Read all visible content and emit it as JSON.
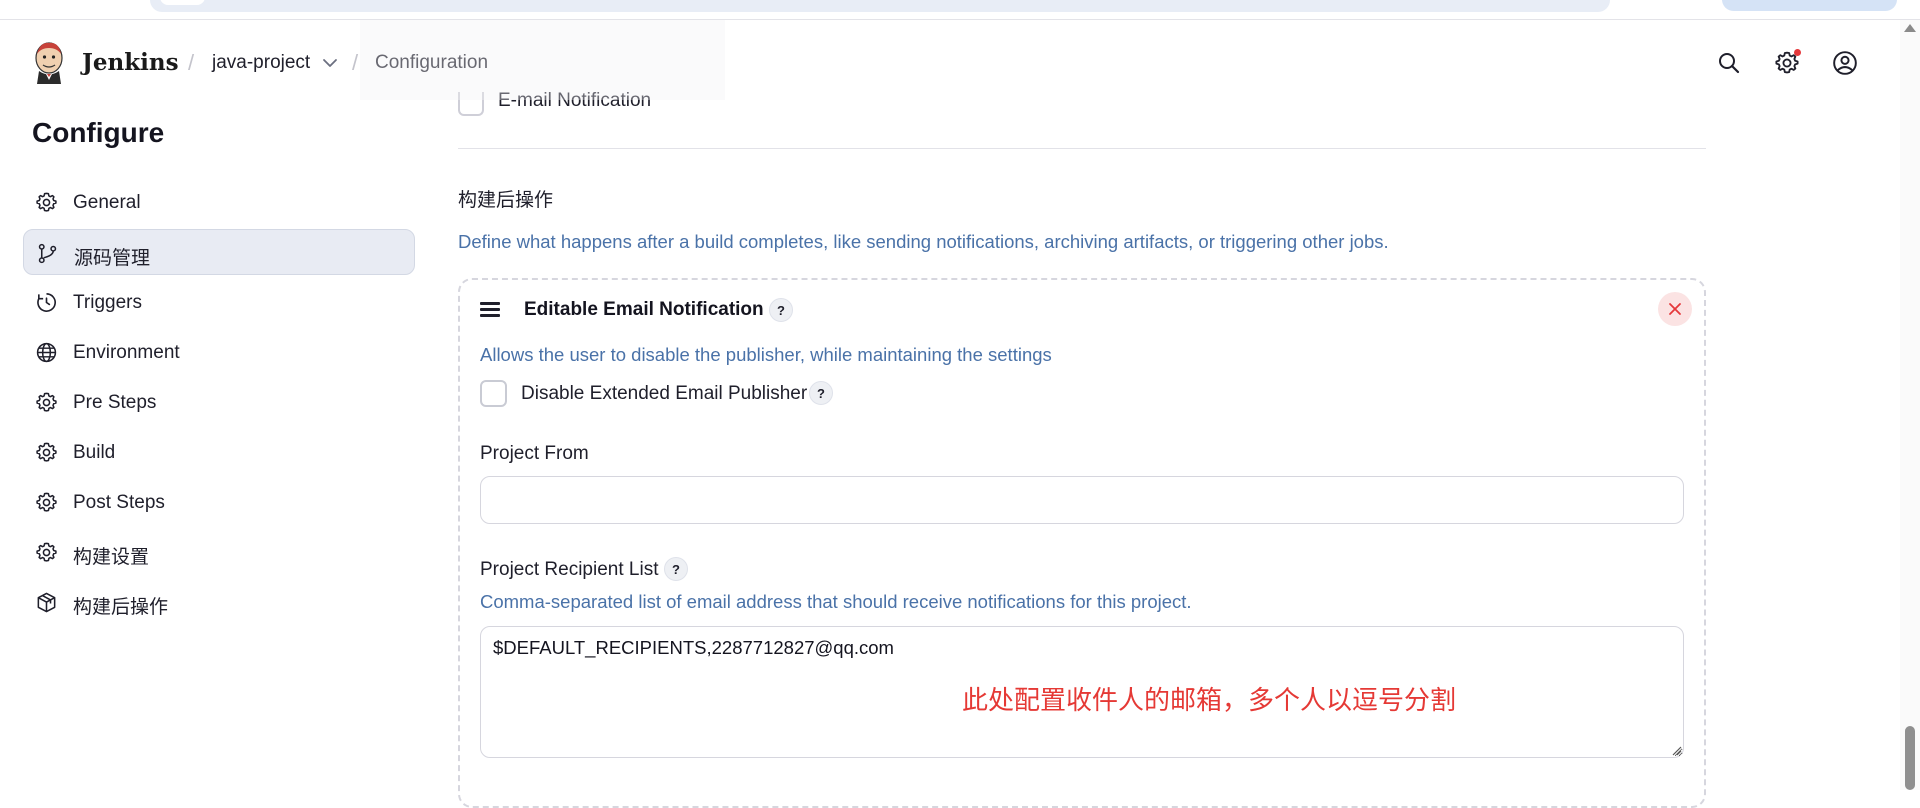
{
  "header": {
    "brand": "Jenkins",
    "breadcrumb": [
      {
        "label": "java-project"
      },
      {
        "label": "Configuration"
      }
    ],
    "separator": "/",
    "icons": [
      "search-icon",
      "settings-icon",
      "user-icon"
    ]
  },
  "sidebar": {
    "title": "Configure",
    "items": [
      {
        "label": "General",
        "icon": "gear-icon",
        "active": false
      },
      {
        "label": "源码管理",
        "icon": "branch-icon",
        "active": true
      },
      {
        "label": "Triggers",
        "icon": "clock-icon",
        "active": false
      },
      {
        "label": "Environment",
        "icon": "globe-icon",
        "active": false
      },
      {
        "label": "Pre Steps",
        "icon": "gear-icon",
        "active": false
      },
      {
        "label": "Build",
        "icon": "gear-icon",
        "active": false
      },
      {
        "label": "Post Steps",
        "icon": "gear-icon",
        "active": false
      },
      {
        "label": "构建设置",
        "icon": "gear-icon",
        "active": false
      },
      {
        "label": "构建后操作",
        "icon": "package-icon",
        "active": false
      }
    ]
  },
  "main": {
    "top_checkbox_label": "E-mail Notification",
    "section_title": "构建后操作",
    "section_desc": "Define what happens after a build completes, like sending notifications, archiving artifacts, or triggering other jobs.",
    "panel": {
      "title": "Editable Email Notification",
      "help": "?",
      "description": "Allows the user to disable the publisher, while maintaining the settings",
      "disable_checkbox_label": "Disable Extended Email Publisher",
      "disable_checked": false,
      "project_from_label": "Project From",
      "project_from_value": "",
      "recipient_label": "Project Recipient List",
      "recipient_desc": "Comma-separated list of email address that should receive notifications for this project.",
      "recipient_value": "$DEFAULT_RECIPIENTS,2287712827@qq.com",
      "annotation": "此处配置收件人的邮箱，多个人以逗号分割"
    }
  },
  "colors": {
    "accent_blue_text": "#4a72a8",
    "active_bg": "#e8ebf3",
    "annotation_red": "#e53935",
    "notification_dot": "#e5383b",
    "close_btn_bg": "#fbe3e3"
  }
}
